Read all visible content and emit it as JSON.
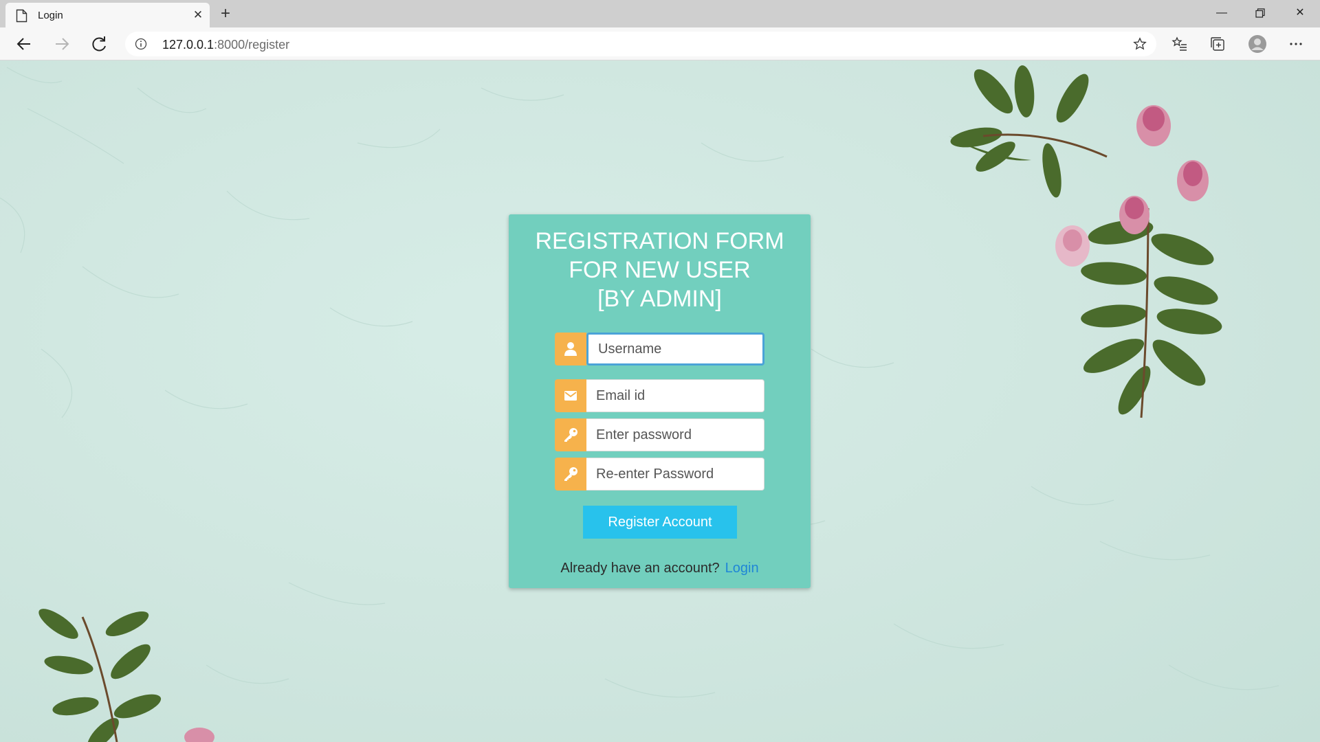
{
  "browser": {
    "tab_title": "Login",
    "url_host": "127.0.0.1",
    "url_rest": ":8000/register",
    "icons": [
      "page-icon",
      "close-icon",
      "plus-icon",
      "minimize-icon",
      "restore-icon",
      "window-close-icon",
      "back-icon",
      "forward-icon",
      "refresh-icon",
      "info-icon",
      "star-icon",
      "favorites-icon",
      "collections-icon",
      "profile-icon",
      "more-icon"
    ]
  },
  "form": {
    "title_line1": "REGISTRATION FORM",
    "title_line2": "FOR NEW USER",
    "title_line3": "[BY ADMIN]",
    "username_placeholder": "Username",
    "email_placeholder": "Email id",
    "password_placeholder": "Enter password",
    "repassword_placeholder": "Re-enter Password",
    "submit_label": "Register Account",
    "footer_text": "Already have an account?",
    "login_link": "Login",
    "icons": [
      "user-icon",
      "envelope-icon",
      "key-icon",
      "key-icon"
    ]
  },
  "colors": {
    "card_bg": "#72cfbe",
    "addon_bg": "#f6b24c",
    "button_bg": "#28c2ec",
    "link": "#1f86d6"
  }
}
